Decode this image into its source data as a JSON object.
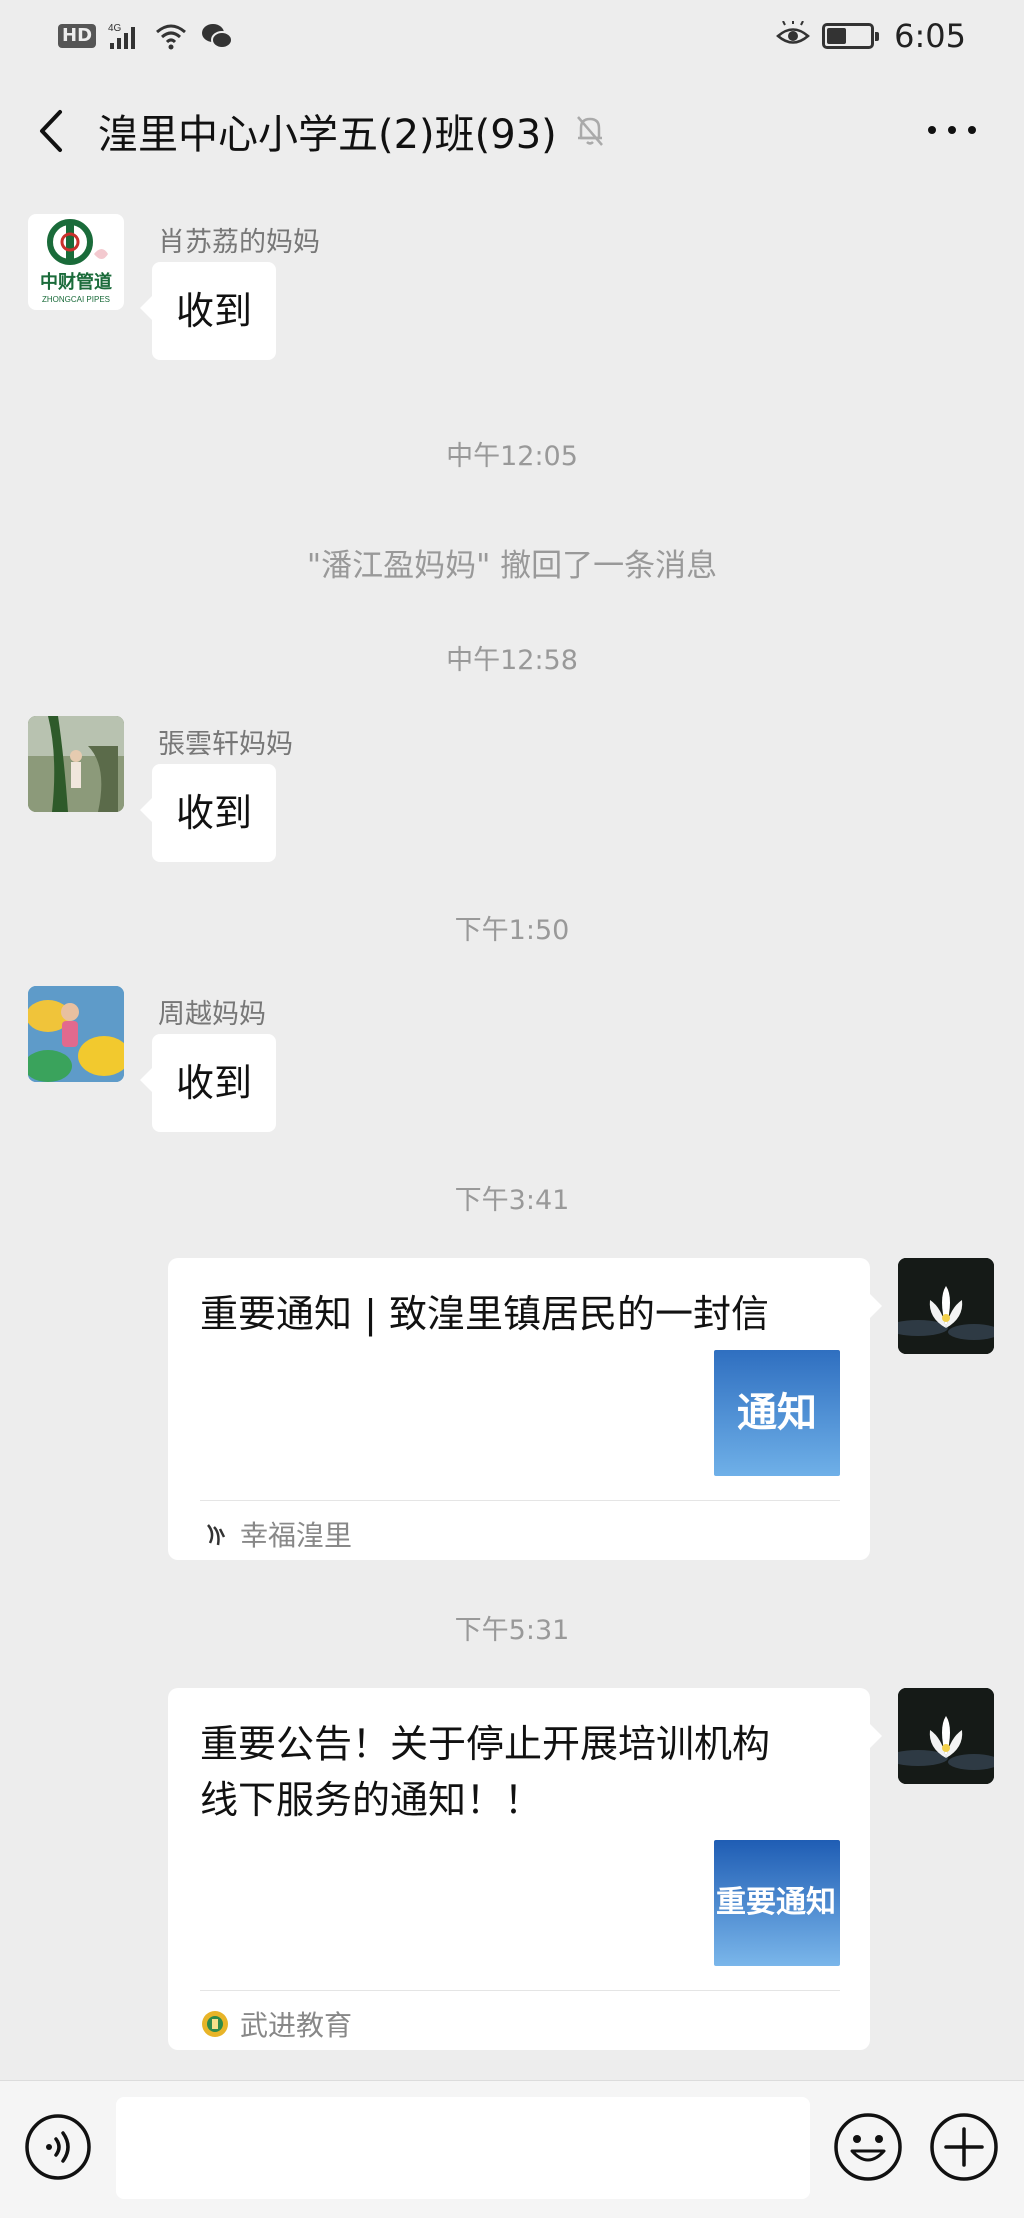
{
  "status_bar": {
    "hd_label": "HD",
    "network_label": "4G",
    "time": "6:05"
  },
  "header": {
    "title": "湟里中心小学五(2)班(93)"
  },
  "messages": [
    {
      "sender": "肖苏荔的妈妈",
      "text": "收到"
    },
    {
      "timestamp": "中午12:05"
    },
    {
      "system": "\"潘江盈妈妈\" 撤回了一条消息"
    },
    {
      "timestamp": "中午12:58"
    },
    {
      "sender": "張雲轩妈妈",
      "text": "收到"
    },
    {
      "timestamp": "下午1:50"
    },
    {
      "sender": "周越妈妈",
      "text": "收到"
    },
    {
      "timestamp": "下午3:41"
    },
    {
      "card_title": "重要通知 | 致湟里镇居民的一封信",
      "thumb_text": "通知",
      "source": "幸福湟里"
    },
    {
      "timestamp": "下午5:31"
    },
    {
      "card_title_line1": "重要公告！关于停止开展培训机构",
      "card_title_line2": "线下服务的通知！！",
      "thumb_text": "重要通知",
      "source": "武进教育"
    }
  ],
  "avatar_logo": {
    "brand_cn": "中财管道",
    "brand_en": "ZHONGCAI PIPES"
  },
  "colors": {
    "background": "#ededed",
    "bubble": "#ffffff",
    "timestamp": "#999999",
    "brand_green": "#1a6b3a",
    "thumb_blue": "#2f7fd0"
  }
}
